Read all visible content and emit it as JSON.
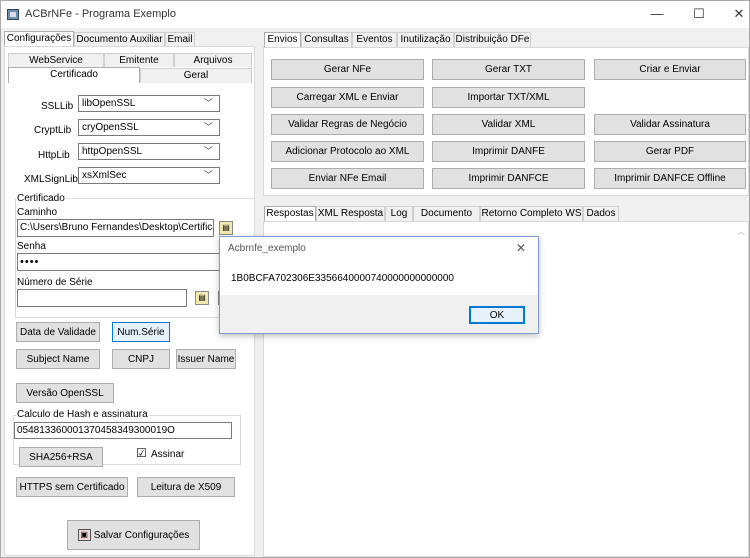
{
  "window": {
    "title": "ACBrNFe - Programa Exemplo",
    "minimize": "—",
    "maximize": "☐",
    "close": "✕"
  },
  "left_tabs": [
    "Configurações",
    "Documento Auxiliar",
    "Email"
  ],
  "sub_tabs_row1": [
    "WebService",
    "Emitente",
    "Arquivos"
  ],
  "sub_tabs_row2": [
    "Certificado",
    "Geral"
  ],
  "libs": [
    {
      "label": "SSLLib",
      "value": "libOpenSSL"
    },
    {
      "label": "CryptLib",
      "value": "cryOpenSSL"
    },
    {
      "label": "HttpLib",
      "value": "httpOpenSSL"
    },
    {
      "label": "XMLSignLib",
      "value": "xsXmlSec"
    }
  ],
  "certificado": {
    "group": "Certificado",
    "caminho_label": "Caminho",
    "caminho_value": "C:\\Users\\Bruno Fernandes\\Desktop\\Certificac",
    "senha_label": "Senha",
    "senha_value": "••••",
    "serie_label": "Número de Série",
    "serie_value": ""
  },
  "cert_buttons": {
    "data_validade": "Data de Validade",
    "num_serie": "Num.Série",
    "subject": "Subject Name",
    "cnpj": "CNPJ",
    "issuer": "Issuer Name",
    "versao": "Versão OpenSSL"
  },
  "hash": {
    "group": "Calculo de Hash e assinatura",
    "value": "054813360001370458349300019O",
    "sha_button": "SHA256+RSA",
    "assinar_label": "Assinar",
    "assinar_checked": "☑"
  },
  "bottom_buttons": {
    "https": "HTTPS sem Certificado",
    "leitura": "Leitura de X509",
    "salvar": "Salvar Configurações"
  },
  "right_tabs": [
    "Envios",
    "Consultas",
    "Eventos",
    "Inutilização",
    "Distribuição DFe"
  ],
  "action_buttons": [
    [
      "Gerar NFe",
      "Gerar TXT",
      "Criar e Enviar"
    ],
    [
      "Carregar XML e Enviar",
      "Importar TXT/XML",
      ""
    ],
    [
      "Validar Regras de Negócio",
      "Validar XML",
      "Validar Assinatura"
    ],
    [
      "Adicionar Protocolo ao XML",
      "Imprimir DANFE",
      "Gerar PDF"
    ],
    [
      "Enviar NFe Email",
      "Imprimir DANFCE",
      "Imprimir DANFCE Offline"
    ]
  ],
  "result_tabs": [
    "Respostas",
    "XML Resposta",
    "Log",
    "Documento",
    "Retorno Completo WS",
    "Dados"
  ],
  "dialog": {
    "title": "Acbrnfe_exemplo",
    "message": "1B0BCFA702306E3356640000740000000000000",
    "ok": "OK",
    "close": "✕"
  }
}
